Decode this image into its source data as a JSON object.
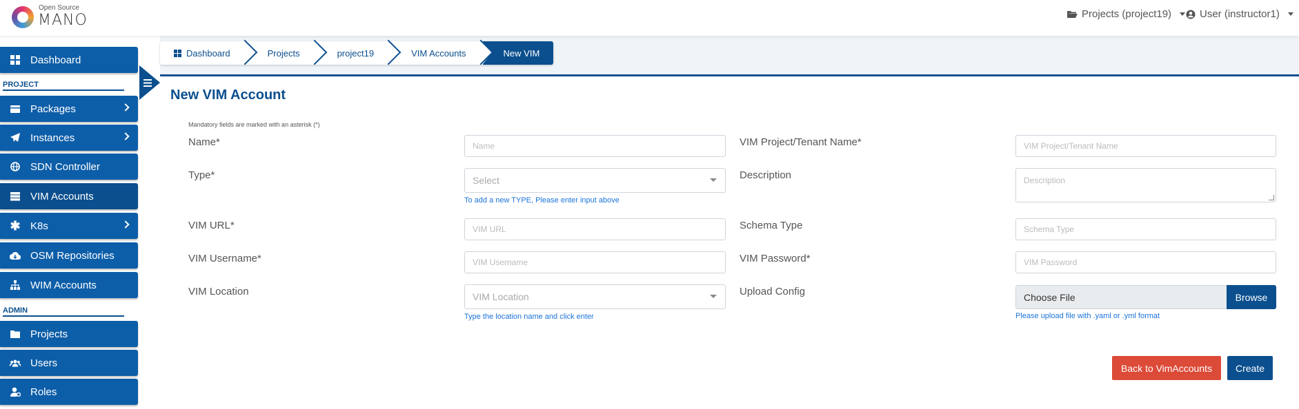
{
  "header": {
    "logo_small": "Open Source",
    "logo_big": "MANO",
    "projects_menu": "Projects (project19)",
    "user_menu": "User (instructor1)"
  },
  "sidebar": {
    "sections": {
      "project": "PROJECT",
      "admin": "ADMIN"
    },
    "items": [
      {
        "label": "Dashboard",
        "icon": "dashboard-icon"
      },
      {
        "label": "Packages",
        "icon": "package-icon"
      },
      {
        "label": "Instances",
        "icon": "paper-plane-icon"
      },
      {
        "label": "SDN Controller",
        "icon": "globe-icon"
      },
      {
        "label": "VIM Accounts",
        "icon": "server-icon"
      },
      {
        "label": "K8s",
        "icon": "asterisk-icon"
      },
      {
        "label": "OSM Repositories",
        "icon": "cloud-download-icon"
      },
      {
        "label": "WIM Accounts",
        "icon": "sitemap-icon"
      },
      {
        "label": "Projects",
        "icon": "folder-icon"
      },
      {
        "label": "Users",
        "icon": "users-icon"
      },
      {
        "label": "Roles",
        "icon": "user-cog-icon"
      }
    ]
  },
  "breadcrumb": [
    "Dashboard",
    "Projects",
    "project19",
    "VIM Accounts",
    "New VIM"
  ],
  "page_title": "New VIM Account",
  "mandatory_note": "Mandatory fields are marked with an asterisk (*)",
  "form": {
    "name": {
      "label": "Name*",
      "placeholder": "Name"
    },
    "type": {
      "label": "Type*",
      "placeholder": "Select",
      "hint": "To add a new TYPE, Please enter input above"
    },
    "vim_url": {
      "label": "VIM URL*",
      "placeholder": "VIM URL"
    },
    "vim_username": {
      "label": "VIM Username*",
      "placeholder": "VIM Username"
    },
    "vim_location": {
      "label": "VIM Location",
      "placeholder": "VIM Location",
      "hint": "Type the location name and click enter"
    },
    "tenant": {
      "label": "VIM Project/Tenant Name*",
      "placeholder": "VIM Project/Tenant Name"
    },
    "description": {
      "label": "Description",
      "placeholder": "Description"
    },
    "schema_type": {
      "label": "Schema Type",
      "placeholder": "Schema Type"
    },
    "vim_password": {
      "label": "VIM Password*",
      "placeholder": "VIM Password"
    },
    "upload_config": {
      "label": "Upload Config",
      "file_text": "Choose File",
      "browse": "Browse",
      "hint": "Please upload file with .yaml or .yml format"
    }
  },
  "buttons": {
    "back": "Back to VimAccounts",
    "create": "Create"
  },
  "colors": {
    "primary": "#0b4f8e",
    "danger": "#dc4a38",
    "hint": "#1a73d9"
  }
}
